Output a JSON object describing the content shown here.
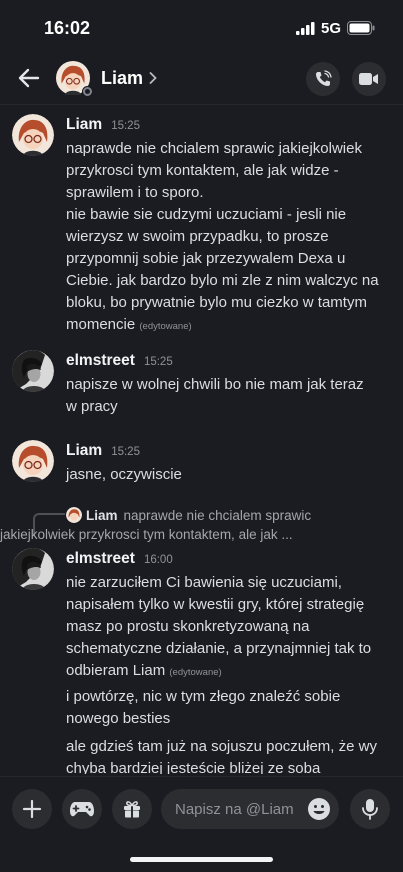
{
  "status_bar": {
    "time": "16:02",
    "network": "5G"
  },
  "header": {
    "name": "Liam"
  },
  "messages": [
    {
      "author": "Liam",
      "time": "15:25",
      "lines": [
        "naprawde nie chcialem sprawic jakiejkolwiek",
        "przykrosci tym kontaktem, ale jak widze -",
        "sprawilem i to sporo.",
        "nie bawie sie cudzymi uczuciami - jesli nie",
        "wierzysz w swoim przypadku, to prosze",
        "przypomnij sobie jak przezywalem Dexa u",
        "Ciebie. jak bardzo bylo mi zle z nim walczyc na",
        "bloku, bo prywatnie bylo mu ciezko w tamtym",
        "momencie"
      ],
      "edited": "(edytowane)"
    },
    {
      "author": "elmstreet",
      "time": "15:25",
      "lines": [
        "napisze w wolnej chwili bo nie mam jak teraz",
        "w pracy"
      ]
    },
    {
      "author": "Liam",
      "time": "15:25",
      "lines": [
        "jasne, oczywiscie"
      ]
    },
    {
      "reply_to": {
        "author": "Liam",
        "line1": "naprawde nie chcialem sprawic",
        "line2": "jakiejkolwiek przykrosci tym kontaktem, ale jak ..."
      },
      "author": "elmstreet",
      "time": "16:00",
      "lines": [
        "nie zarzuciłem Ci bawienia się uczuciami,",
        "napisałem tylko w kwestii gry, której strategię",
        "masz po prostu skonkretyzowaną na",
        "schematyczne działanie, a przynajmniej tak to",
        "odbieram Liam"
      ],
      "edited": "(edytowane)",
      "extra": [
        [
          "i powtórzę, nic w tym złego znaleźć sobie",
          "nowego besties"
        ],
        [
          "ale gdzieś tam już na sojuszu poczułem, że wy",
          "chyba bardziej jesteście bliżej ze soba"
        ]
      ]
    }
  ],
  "composer": {
    "placeholder": "Napisz na @Liam"
  },
  "colors": {
    "background": "#1b1c21",
    "button": "#2b2d31",
    "text": "#dbdee1",
    "muted": "#8e9297"
  }
}
